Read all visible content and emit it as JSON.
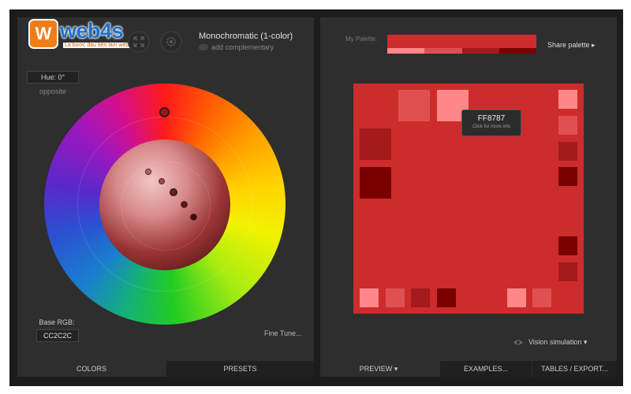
{
  "logo": {
    "badge": "W",
    "text": "web4s",
    "sub": "Là bước đầu tiên làm web"
  },
  "scheme": {
    "title": "Monochromatic (1-color)",
    "complement_label": "add complementary"
  },
  "hue": {
    "label": "Hue: 0°",
    "opposite_label": "opposite"
  },
  "base": {
    "label": "Base RGB:",
    "value": "CC2C2C"
  },
  "fine_tune": "Fine Tune...",
  "tabs": {
    "colors": "COLORS",
    "presets": "PRESETS",
    "preview": "PREVIEW ▾",
    "examples": "EXAMPLES...",
    "tables": "TABLES / EXPORT..."
  },
  "palette": {
    "label": "My Palette:",
    "base_color": "#CC2C2C",
    "shades": [
      "#FF8787",
      "#E05050",
      "#A51A1A",
      "#7A0000"
    ]
  },
  "share_label": "Share palette ▸",
  "tooltip": {
    "hex": "FF8787",
    "hint": "Click for more info"
  },
  "vision_label": "Vision simulation ▾",
  "colors": {
    "base": "#CC2C2C",
    "light": "#FF8787",
    "mid_light": "#E05050",
    "dark": "#A51A1A",
    "darkest": "#7A0000"
  }
}
